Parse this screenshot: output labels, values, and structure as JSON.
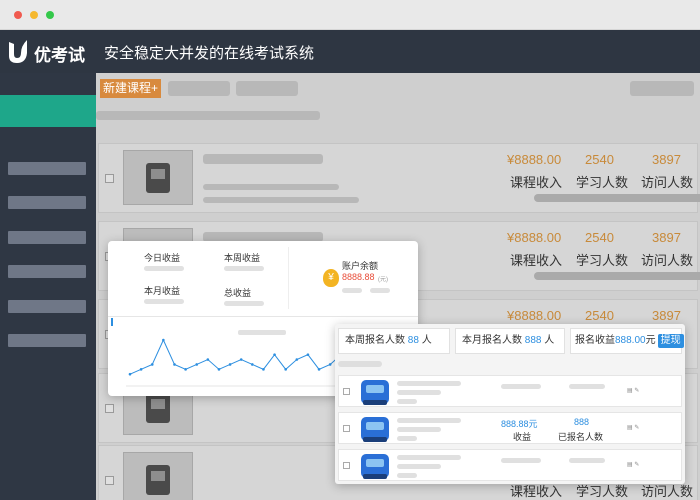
{
  "header": {
    "brand": "优考试",
    "slogan": "安全稳定大并发的在线考试系统"
  },
  "toolbar": {
    "new_course_label": "新建课程+"
  },
  "course_stats": {
    "income_value": "¥8888.00",
    "income_label": "课程收入",
    "learners_value": "2540",
    "learners_label": "学习人数",
    "visits_value": "3897",
    "visits_label": "访问人数"
  },
  "earnings": {
    "today_label": "今日收益",
    "week_label": "本周收益",
    "month_label": "本月收益",
    "total_label": "总收益",
    "balance_label": "账户余额",
    "balance_value": "8888.88",
    "balance_unit": "(元)"
  },
  "registration": {
    "week_label": "本周报名人数",
    "week_value": "88",
    "week_unit": "人",
    "month_label": "本月报名人数",
    "month_value": "888",
    "month_unit": "人",
    "income_label": "报名收益",
    "income_value": "888.00",
    "income_unit": "元",
    "withdraw_label": "提现",
    "row_income_value": "888.88元",
    "row_income_label": "收益",
    "row_count_value": "888",
    "row_count_label": "已报名人数"
  },
  "chart_data": {
    "type": "line",
    "values": [
      2,
      3,
      4,
      9,
      4,
      3,
      4,
      5,
      3,
      4,
      5,
      4,
      3,
      6,
      3,
      5,
      6,
      3,
      4,
      6,
      3,
      4,
      3,
      3,
      4,
      5
    ]
  },
  "colors": {
    "header_bg": "#2e3642",
    "sidebar_active": "#1ea78a",
    "accent_orange": "#d88a3e",
    "accent_blue": "#2d8fe0",
    "balance_red": "#e84e3a"
  }
}
